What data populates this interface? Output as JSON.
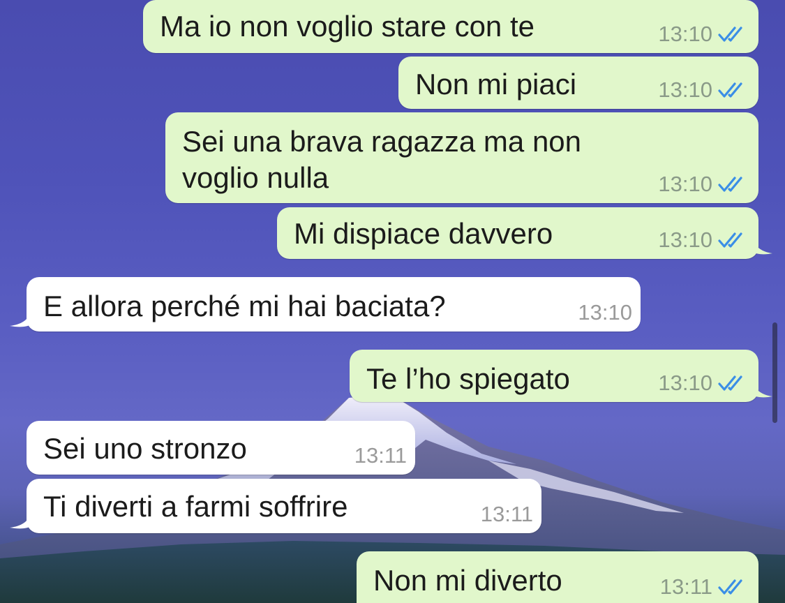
{
  "colors": {
    "outgoing_bubble": "#e1f7cb",
    "incoming_bubble": "#ffffff",
    "read_ticks": "#3a8ee6",
    "wallpaper_sky": "#4f53b9"
  },
  "icons": {
    "read_receipt": "double-check-icon"
  },
  "messages": [
    {
      "direction": "outgoing",
      "text": "Ma io non voglio stare con te",
      "time": "13:10",
      "status": "read"
    },
    {
      "direction": "outgoing",
      "text": "Non mi piaci",
      "time": "13:10",
      "status": "read"
    },
    {
      "direction": "outgoing",
      "text": "Sei una brava ragazza ma non\nvoglio nulla",
      "time": "13:10",
      "status": "read"
    },
    {
      "direction": "outgoing",
      "text": "Mi dispiace davvero",
      "time": "13:10",
      "status": "read"
    },
    {
      "direction": "incoming",
      "text": "E allora perché mi hai baciata?",
      "time": "13:10"
    },
    {
      "direction": "outgoing",
      "text": "Te l’ho spiegato",
      "time": "13:10",
      "status": "read"
    },
    {
      "direction": "incoming",
      "text": "Sei uno stronzo",
      "time": "13:11"
    },
    {
      "direction": "incoming",
      "text": "Ti diverti a farmi soffrire",
      "time": "13:11"
    },
    {
      "direction": "outgoing",
      "text": "Non mi diverto",
      "time": "13:11",
      "status": "read"
    }
  ]
}
